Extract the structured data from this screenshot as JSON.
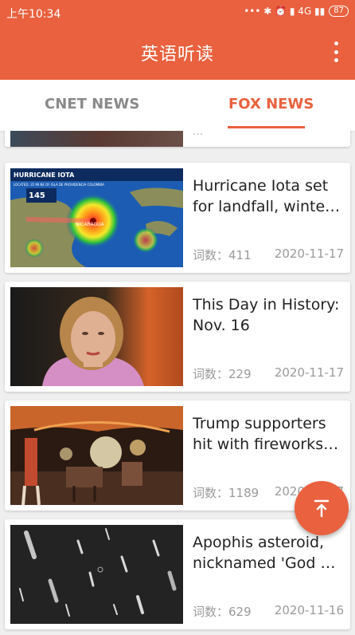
{
  "status_bar": {
    "time": "上午10:34",
    "indicators": "... ✱ ⏰ ⁴ᴳ 4G",
    "battery": "87"
  },
  "app_bar": {
    "title": "英语听读",
    "menu_icon": "more-vert-icon"
  },
  "tabs": [
    {
      "label": "CNET NEWS",
      "selected": false
    },
    {
      "label": "FOX NEWS",
      "selected": true
    }
  ],
  "colors": {
    "accent": "#e9613f",
    "text_primary": "#222222",
    "text_secondary": "#9a9a9a"
  },
  "partial_card": {
    "title_fragment": "..."
  },
  "articles": [
    {
      "title": "Hurricane Iota set for landfall, winter storm",
      "word_count_label": "词数：411",
      "date": "2020-11-17",
      "thumb_caption": "HURRICANE IOTA",
      "thumb_sub": "LOCATED: 35 MI NE OF ISLA DE PROVIDENCIA COLOMBIA",
      "thumb_speed": "145",
      "thumb_map_label": "NICARAGUA"
    },
    {
      "title": "This Day in History: Nov. 16",
      "word_count_label": "词数：229",
      "date": "2020-11-17"
    },
    {
      "title": "Trump supporters hit with fireworks…",
      "word_count_label": "词数：1189",
      "date": "2020-11-17"
    },
    {
      "title": "Apophis asteroid, nicknamed 'God of Chaos'",
      "word_count_label": "词数：629",
      "date": "2020-11-16"
    }
  ],
  "fab": {
    "icon": "scroll-to-top-icon"
  }
}
